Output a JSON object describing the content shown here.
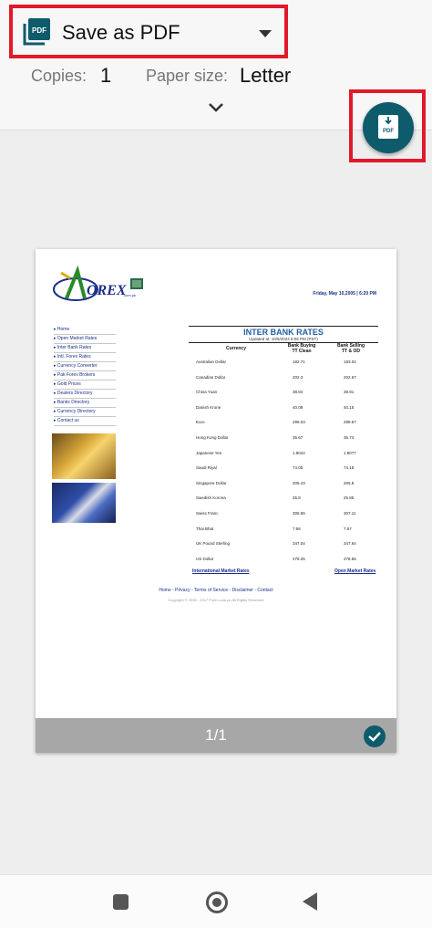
{
  "header": {
    "destination": "Save as PDF",
    "copies_label": "Copies:",
    "copies_value": "1",
    "paper_label": "Paper size:",
    "paper_value": "Letter",
    "pdf_icon_text": "PDF",
    "download_icon_text": "PDF"
  },
  "preview": {
    "logo_text": "OREX",
    "logo_sub": ".com.pk",
    "date": "Friday, May 10,2005 | 6:20 PM",
    "nav": [
      "Home",
      "Open Market Rates",
      "Inter Bank Rates",
      "Intl. Forex Rates",
      "Currency Converter",
      "Pak Forex Brokers",
      "Gold Prices",
      "Dealers Directory",
      "Banks Directory",
      "Currency Directory",
      "Contact us"
    ],
    "table": {
      "title": "INTER BANK RATES",
      "updated": "Updated at: 10/5/2024 8:05 PM (PST)",
      "col_currency": "Currency",
      "col_buy_1": "Bank Buying",
      "col_buy_2": "TT Clean",
      "col_sell_1": "Bank Selling",
      "col_sell_2": "TT & OD",
      "rows": [
        {
          "c": "Australian Dollar",
          "b": "182.71",
          "s": "183.04"
        },
        {
          "c": "Canadian Dollar",
          "b": "202.3",
          "s": "202.67"
        },
        {
          "c": "China Yuan",
          "b": "38.84",
          "s": "38.91"
        },
        {
          "c": "Danish Krone",
          "b": "40.08",
          "s": "40.15"
        },
        {
          "c": "Euro",
          "b": "299.03",
          "s": "299.57"
        },
        {
          "c": "Hong Kong Dollar",
          "b": "35.67",
          "s": "35.74"
        },
        {
          "c": "Japanese Yen",
          "b": "1.8044",
          "s": "1.8077"
        },
        {
          "c": "Saudi Riyal",
          "b": "74.05",
          "s": "74.18"
        },
        {
          "c": "Singapore Dollar",
          "b": "205.43",
          "s": "205.8"
        },
        {
          "c": "Swedish Korona",
          "b": "25.8",
          "s": "25.85"
        },
        {
          "c": "Swiss Franc",
          "b": "306.56",
          "s": "307.11"
        },
        {
          "c": "Thai Bhat",
          "b": "7.56",
          "s": "7.57"
        },
        {
          "c": "UK Pound Sterling",
          "b": "347.04",
          "s": "347.64"
        },
        {
          "c": "US Dollar",
          "b": "278.25",
          "s": "278.55"
        }
      ],
      "link_left": "International Market Rates",
      "link_right": "Open Market Rates"
    },
    "footer": "Home - Privacy - Terms of Service - Disclaimer - Contact",
    "copyright": "Copyright © 2006 - 2017 Forex.com.pk All Rights Reserved",
    "page_indicator": "1/1"
  }
}
